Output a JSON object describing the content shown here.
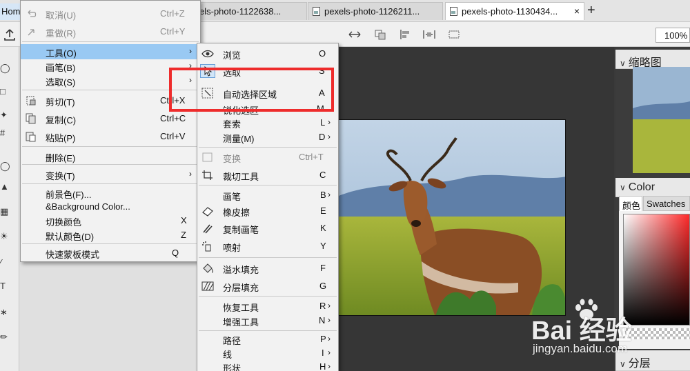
{
  "tabs": {
    "home": "Home",
    "items": [
      {
        "label": "els-photo-1122638..."
      },
      {
        "label": "pexels-photo-1126211..."
      },
      {
        "label": "pexels-photo-1130434..."
      }
    ],
    "close_glyph": "×",
    "add_glyph": "+"
  },
  "options_bar": {
    "zoom": "100%",
    "icons": [
      "upload-icon",
      "move-arrows-icon",
      "transform-icon",
      "align-left-icon",
      "distribute-icon",
      "crop-frame-icon"
    ]
  },
  "menu": {
    "items": [
      {
        "label": "取消(U)",
        "shortcut": "Ctrl+Z",
        "icon": "undo-icon",
        "disabled": true
      },
      {
        "label": "重做(R)",
        "shortcut": "Ctrl+Y",
        "icon": "redo-icon",
        "disabled": true
      },
      {
        "label": "工具(O)",
        "submenu": true,
        "highlighted": true
      },
      {
        "label": "画笔(B)",
        "submenu": true
      },
      {
        "label": "选取(S)",
        "submenu": true
      },
      {
        "label": "剪切(T)",
        "shortcut": "Ctrl+X",
        "icon": "cut-icon"
      },
      {
        "label": "复制(C)",
        "shortcut": "Ctrl+C",
        "icon": "copy-icon"
      },
      {
        "label": "粘贴(P)",
        "shortcut": "Ctrl+V",
        "icon": "paste-icon"
      },
      {
        "label": "删除(E)"
      },
      {
        "label": "变换(T)",
        "submenu": true
      },
      {
        "label": "前景色(F)..."
      },
      {
        "label": "&Background Color..."
      },
      {
        "label": "切换颜色",
        "shortcut": "X"
      },
      {
        "label": "默认颜色(D)",
        "shortcut": "Z"
      },
      {
        "label": "快速蒙板模式",
        "shortcut": "Q"
      }
    ]
  },
  "submenu": {
    "items": [
      {
        "label": "浏览",
        "shortcut": "O",
        "icon": "eye-icon"
      },
      {
        "label": "选取",
        "shortcut": "S",
        "icon": "select-arrow-icon"
      },
      {
        "label": "自动选择区域",
        "shortcut": "A",
        "icon": "auto-select-icon"
      },
      {
        "label": "锐化选区",
        "shortcut": "M"
      },
      {
        "label": "套索",
        "shortcut": "L",
        "submenu": true
      },
      {
        "label": "测量(M)",
        "shortcut": "D",
        "submenu": true
      },
      {
        "label": "变换",
        "shortcut": "Ctrl+T",
        "icon": "transform-icon",
        "disabled": true
      },
      {
        "label": "裁切工具",
        "shortcut": "C",
        "icon": "crop-icon"
      },
      {
        "label": "画笔",
        "shortcut": "B",
        "submenu": true
      },
      {
        "label": "橡皮擦",
        "shortcut": "E",
        "icon": "eraser-icon"
      },
      {
        "label": "复制画笔",
        "shortcut": "K",
        "icon": "clone-brush-icon"
      },
      {
        "label": "喷射",
        "shortcut": "Y",
        "icon": "spray-icon"
      },
      {
        "label": "溢水填充",
        "shortcut": "F",
        "icon": "flood-fill-icon"
      },
      {
        "label": "分层填充",
        "shortcut": "G",
        "icon": "gradient-fill-icon"
      },
      {
        "label": "恢复工具",
        "shortcut": "R",
        "submenu": true
      },
      {
        "label": "增强工具",
        "shortcut": "N",
        "submenu": true
      },
      {
        "label": "路径",
        "shortcut": "P",
        "submenu": true
      },
      {
        "label": "线",
        "shortcut": "I",
        "submenu": true
      },
      {
        "label": "形状",
        "shortcut": "H",
        "submenu": true
      }
    ]
  },
  "panels": {
    "navigator": "缩略图",
    "color": "Color",
    "color_tabs": [
      "颜色",
      "Swatches"
    ],
    "layers": "分层"
  },
  "watermark": {
    "brand": "Bai 经验",
    "url": "jingyan.baidu.com"
  },
  "colors": {
    "menu_highlight": "#99c9f3",
    "annotation": "#ee2c2c",
    "canvas_bg": "#363636"
  }
}
